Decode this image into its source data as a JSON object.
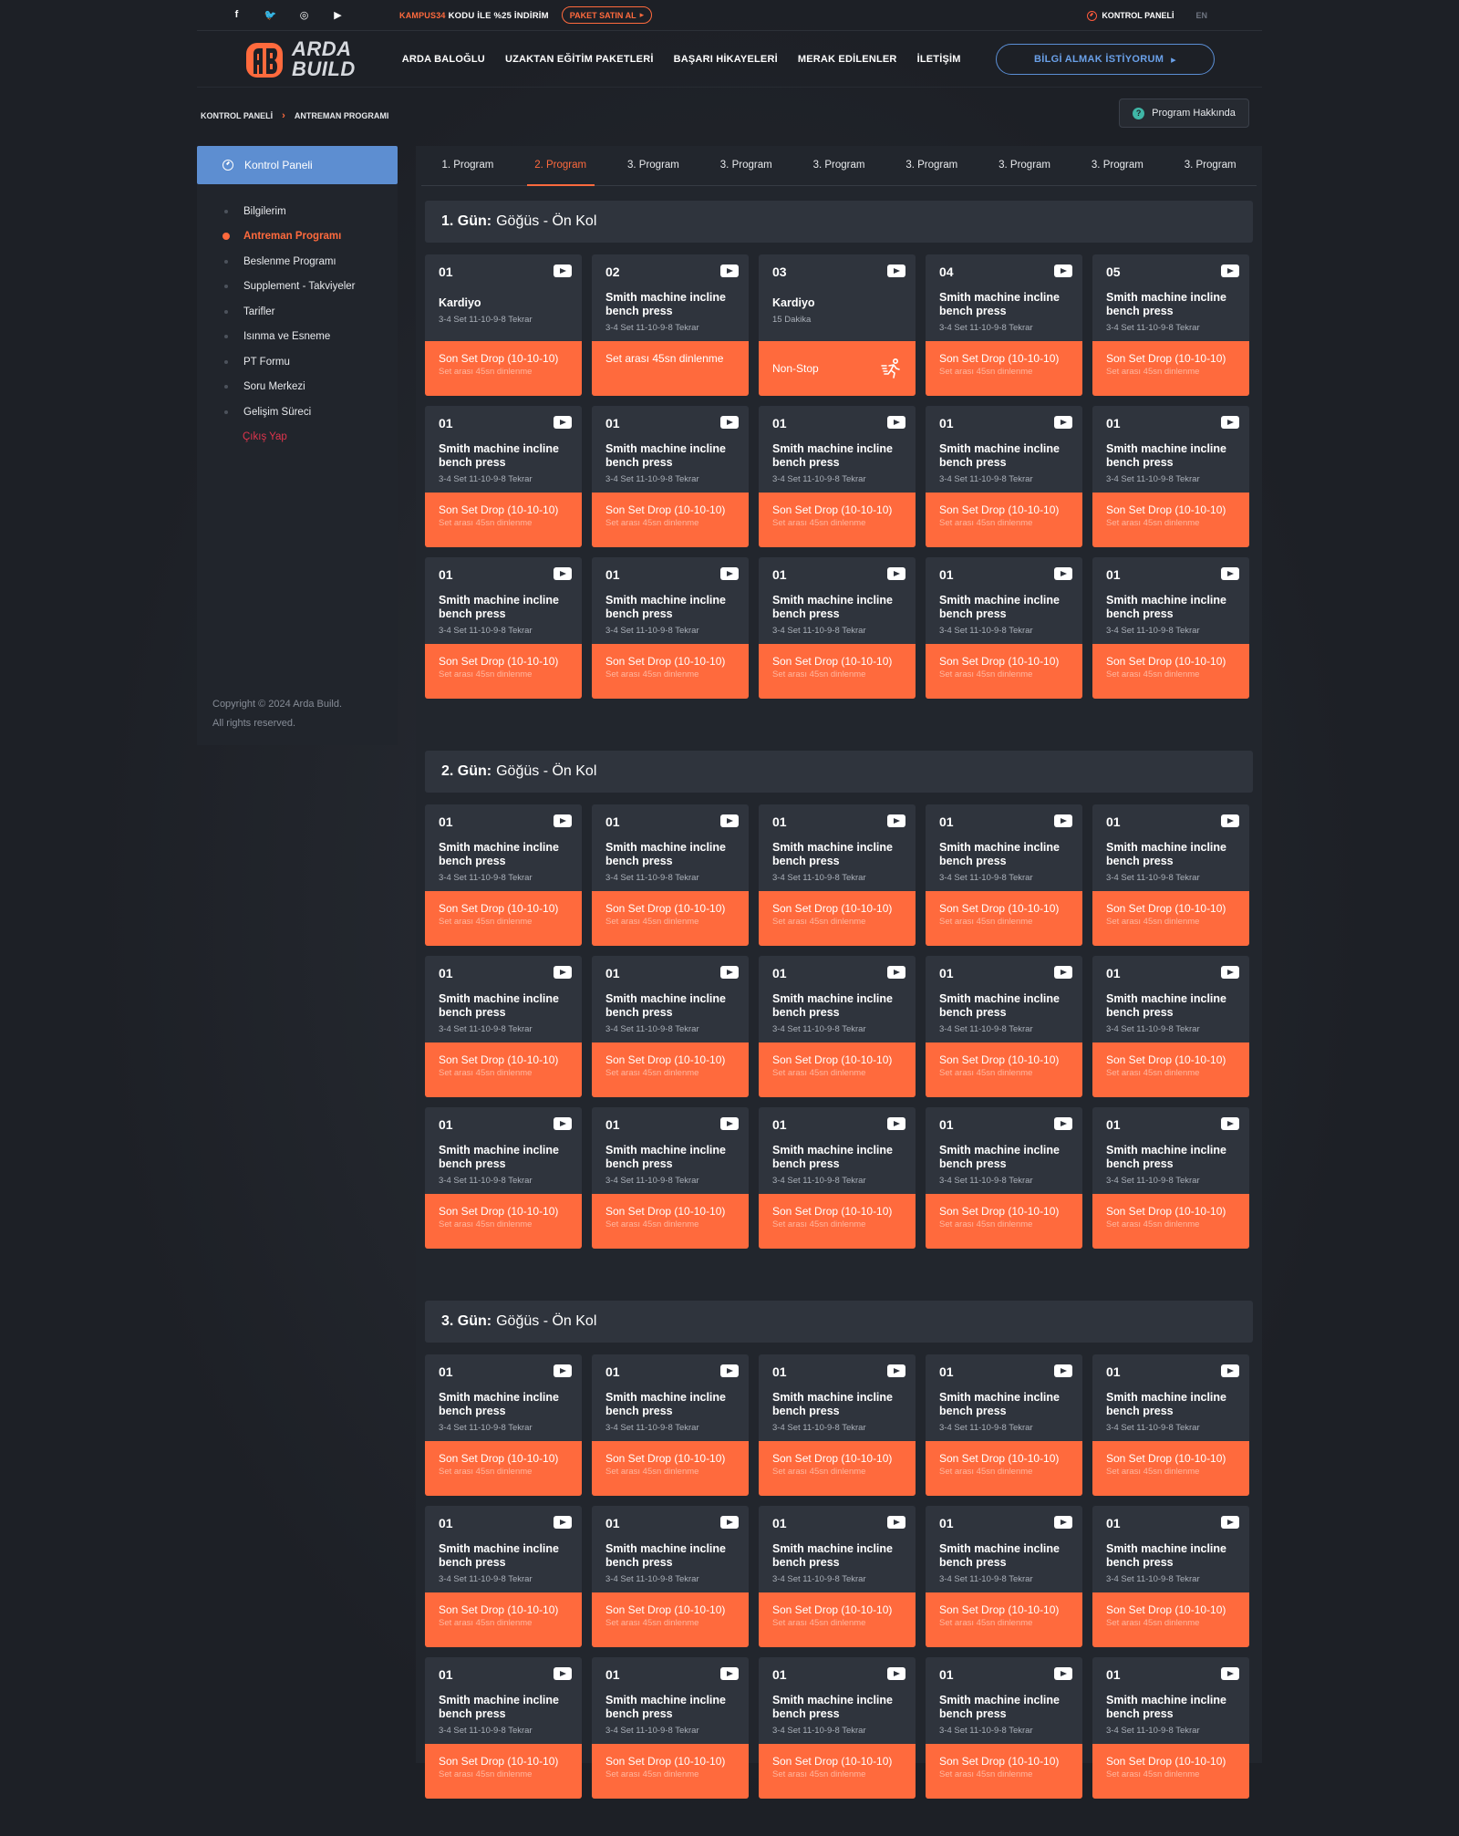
{
  "topbar": {
    "social": [
      {
        "name": "facebook-icon",
        "glyph": "f"
      },
      {
        "name": "twitter-icon",
        "glyph": "🐦"
      },
      {
        "name": "instagram-icon",
        "glyph": "◎"
      },
      {
        "name": "youtube-icon",
        "glyph": "▶"
      }
    ],
    "promo_code": "KAMPUS34",
    "promo_text": "KODU İLE %25 İNDİRİM",
    "package_button": "PAKET SATIN AL",
    "control_panel": "KONTROL PANELİ",
    "language": "EN"
  },
  "header": {
    "logo_line1": "ARDA",
    "logo_line2": "BUILD",
    "nav": [
      "ARDA BALOĞLU",
      "UZAKTAN EĞİTİM PAKETLERİ",
      "BAŞARI HİKAYELERİ",
      "MERAK EDİLENLER",
      "İLETİŞİM"
    ],
    "info_button": "BİLGİ ALMAK İSTİYORUM"
  },
  "breadcrumb": {
    "root": "KONTROL PANELİ",
    "current": "ANTREMAN PROGRAMI"
  },
  "about_button": "Program Hakkında",
  "sidebar": {
    "head": "Kontrol Paneli",
    "items": [
      "Bilgilerim",
      "Antreman Programı",
      "Beslenme Programı",
      "Supplement - Takviyeler",
      "Tarifler",
      "Isınma ve Esneme",
      "PT Formu",
      "Soru Merkezi",
      "Gelişim Süreci",
      "Çıkış Yap"
    ],
    "active_index": 1,
    "copyright_1": "Copyright © 2024 Arda Build.",
    "copyright_2": "All rights reserved."
  },
  "tabs": [
    "1. Program",
    "2. Program",
    "3. Program",
    "3. Program",
    "3. Program",
    "3. Program",
    "3. Program",
    "3. Program",
    "3. Program"
  ],
  "active_tab": 1,
  "days": [
    {
      "label": "1. Gün:",
      "title": "Göğüs - Ön Kol",
      "cards": [
        {
          "num": "01",
          "name": "Kardiyo",
          "sub": "3-4 Set 11-10-9-8 Tekrar",
          "drop": "Son Set Drop (10-10-10)",
          "rest": "Set arası 45sn dinlenme",
          "variant": "single"
        },
        {
          "num": "02",
          "name": "Smith machine incline bench press",
          "sub": "3-4 Set 11-10-9-8 Tekrar",
          "big": "Set arası 45sn dinlenme",
          "variant": "big"
        },
        {
          "num": "03",
          "name": "Kardiyo",
          "sub": "15 Dakika",
          "nonstop": "Non-Stop",
          "variant": "nonstop"
        },
        {
          "num": "04",
          "name": "Smith machine incline bench press",
          "sub": "3-4 Set 11-10-9-8 Tekrar",
          "drop": "Son Set Drop (10-10-10)",
          "rest": "Set arası 45sn dinlenme"
        },
        {
          "num": "05",
          "name": "Smith machine incline bench press",
          "sub": "3-4 Set 11-10-9-8 Tekrar",
          "drop": "Son Set Drop (10-10-10)",
          "rest": "Set arası 45sn dinlenme"
        },
        {
          "num": "01",
          "name": "Smith machine incline bench press",
          "sub": "3-4 Set 11-10-9-8 Tekrar",
          "drop": "Son Set Drop (10-10-10)",
          "rest": "Set arası 45sn dinlenme"
        },
        {
          "num": "01",
          "name": "Smith machine incline bench press",
          "sub": "3-4 Set 11-10-9-8 Tekrar",
          "drop": "Son Set Drop (10-10-10)",
          "rest": "Set arası 45sn dinlenme"
        },
        {
          "num": "01",
          "name": "Smith machine incline bench press",
          "sub": "3-4 Set 11-10-9-8 Tekrar",
          "drop": "Son Set Drop (10-10-10)",
          "rest": "Set arası 45sn dinlenme"
        },
        {
          "num": "01",
          "name": "Smith machine incline bench press",
          "sub": "3-4 Set 11-10-9-8 Tekrar",
          "drop": "Son Set Drop (10-10-10)",
          "rest": "Set arası 45sn dinlenme"
        },
        {
          "num": "01",
          "name": "Smith machine incline bench press",
          "sub": "3-4 Set 11-10-9-8 Tekrar",
          "drop": "Son Set Drop (10-10-10)",
          "rest": "Set arası 45sn dinlenme"
        },
        {
          "num": "01",
          "name": "Smith machine incline bench press",
          "sub": "3-4 Set 11-10-9-8 Tekrar",
          "drop": "Son Set Drop (10-10-10)",
          "rest": "Set arası 45sn dinlenme"
        },
        {
          "num": "01",
          "name": "Smith machine incline bench press",
          "sub": "3-4 Set 11-10-9-8 Tekrar",
          "drop": "Son Set Drop (10-10-10)",
          "rest": "Set arası 45sn dinlenme"
        },
        {
          "num": "01",
          "name": "Smith machine incline bench press",
          "sub": "3-4 Set 11-10-9-8 Tekrar",
          "drop": "Son Set Drop (10-10-10)",
          "rest": "Set arası 45sn dinlenme"
        },
        {
          "num": "01",
          "name": "Smith machine incline bench press",
          "sub": "3-4 Set 11-10-9-8 Tekrar",
          "drop": "Son Set Drop (10-10-10)",
          "rest": "Set arası 45sn dinlenme"
        },
        {
          "num": "01",
          "name": "Smith machine incline bench press",
          "sub": "3-4 Set 11-10-9-8 Tekrar",
          "drop": "Son Set Drop (10-10-10)",
          "rest": "Set arası 45sn dinlenme"
        }
      ]
    },
    {
      "label": "2. Gün:",
      "title": "Göğüs - Ön Kol",
      "repeat": {
        "num": "01",
        "name": "Smith machine incline bench press",
        "sub": "3-4 Set 11-10-9-8 Tekrar",
        "drop": "Son Set Drop (10-10-10)",
        "rest": "Set arası 45sn dinlenme"
      },
      "count": 15
    },
    {
      "label": "3. Gün:",
      "title": "Göğüs - Ön Kol",
      "repeat": {
        "num": "01",
        "name": "Smith machine incline bench press",
        "sub": "3-4 Set 11-10-9-8 Tekrar",
        "drop": "Son Set Drop (10-10-10)",
        "rest": "Set arası 45sn dinlenme"
      },
      "count": 15
    }
  ],
  "colors": {
    "accent": "#ff6a3d",
    "blue": "#5d8ed1",
    "card": "#2f343d",
    "panel": "#22262d",
    "bg": "#1d2026"
  }
}
